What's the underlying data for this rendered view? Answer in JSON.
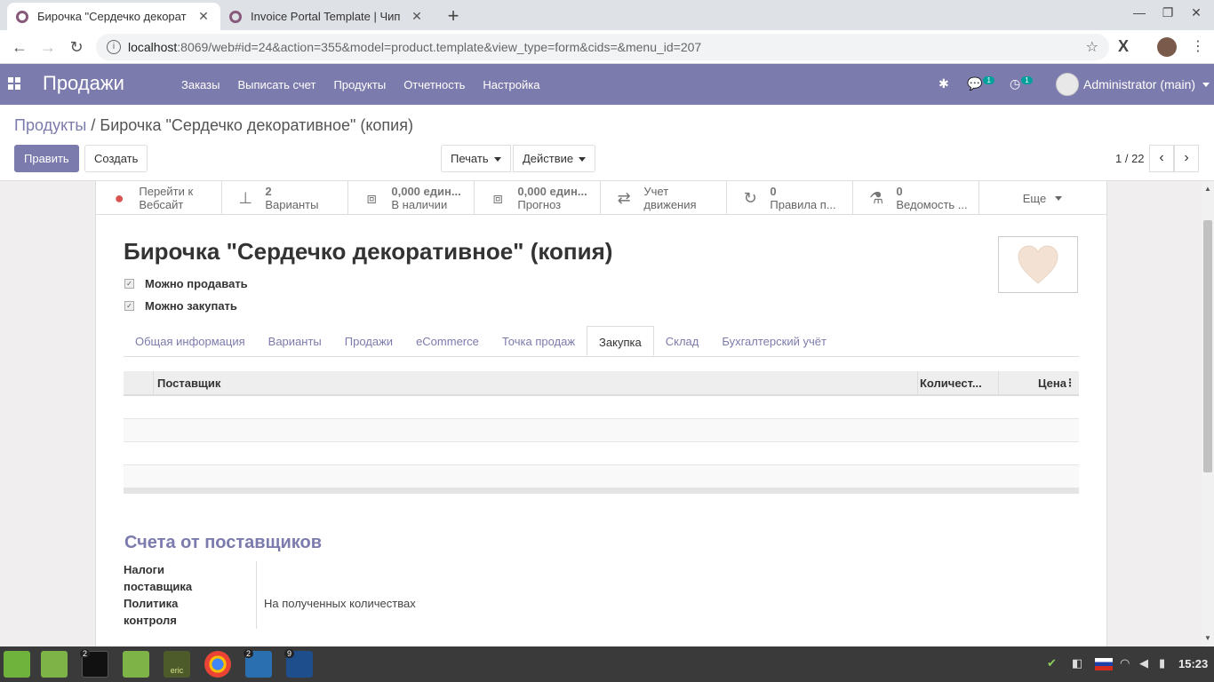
{
  "browser": {
    "tabs": [
      {
        "title": "Бирочка \"Сердечко декорат",
        "active": true
      },
      {
        "title": "Invoice Portal Template | Чип",
        "active": false
      }
    ],
    "url_host": "localhost",
    "url_path": ":8069/web#id=24&action=355&model=product.template&view_type=form&cids=&menu_id=207"
  },
  "navbar": {
    "app_name": "Продажи",
    "menu": [
      "Заказы",
      "Выписать счет",
      "Продукты",
      "Отчетность",
      "Настройка"
    ],
    "messages_count": "1",
    "activities_count": "1",
    "user": "Administrator (main)",
    "color": "#7c7bad"
  },
  "control_panel": {
    "breadcrumb_parent": "Продукты",
    "breadcrumb_separator": "/",
    "breadcrumb_current": "Бирочка \"Сердечко декоративное\" (копия)",
    "edit_label": "Править",
    "create_label": "Создать",
    "print_label": "Печать",
    "action_label": "Действие",
    "pager": "1 / 22"
  },
  "smart_buttons": [
    {
      "icon": "globe-icon",
      "value": "Перейти к",
      "label": "Вебсайт"
    },
    {
      "icon": "sitemap-icon",
      "value": "2",
      "label": "Варианты"
    },
    {
      "icon": "cubes-icon",
      "value": "0,000 един...",
      "label": "В наличии"
    },
    {
      "icon": "cubes-icon",
      "value": "0,000 един...",
      "label": "Прогноз"
    },
    {
      "icon": "exchange-icon",
      "value": "Учет",
      "label": "движения"
    },
    {
      "icon": "refresh-icon",
      "value": "0",
      "label": "Правила п..."
    },
    {
      "icon": "flask-icon",
      "value": "0",
      "label": "Ведомость ..."
    }
  ],
  "more_label": "Еще",
  "product": {
    "name": "Бирочка \"Сердечко декоративное\" (копия)",
    "can_be_sold_label": "Можно продавать",
    "can_be_purchased_label": "Можно закупать"
  },
  "notebook_tabs": [
    "Общая информация",
    "Варианты",
    "Продажи",
    "eCommerce",
    "Точка продаж",
    "Закупка",
    "Склад",
    "Бухгалтерский учёт"
  ],
  "active_tab": "Закупка",
  "vendor_table": {
    "col_vendor": "Поставщик",
    "col_qty": "Количест...",
    "col_price": "Цена"
  },
  "vendor_bills": {
    "section_title": "Счета от поставщиков",
    "taxes_label_1": "Налоги",
    "taxes_label_2": "поставщика",
    "policy_label_1": "Политика",
    "policy_label_2": "контроля",
    "policy_value": "На полученных количествах"
  },
  "taskbar": {
    "terminal_badge": "2",
    "editor_badge": "2",
    "camera_badge": "9",
    "eric_label": "eric",
    "clock": "15:23"
  }
}
